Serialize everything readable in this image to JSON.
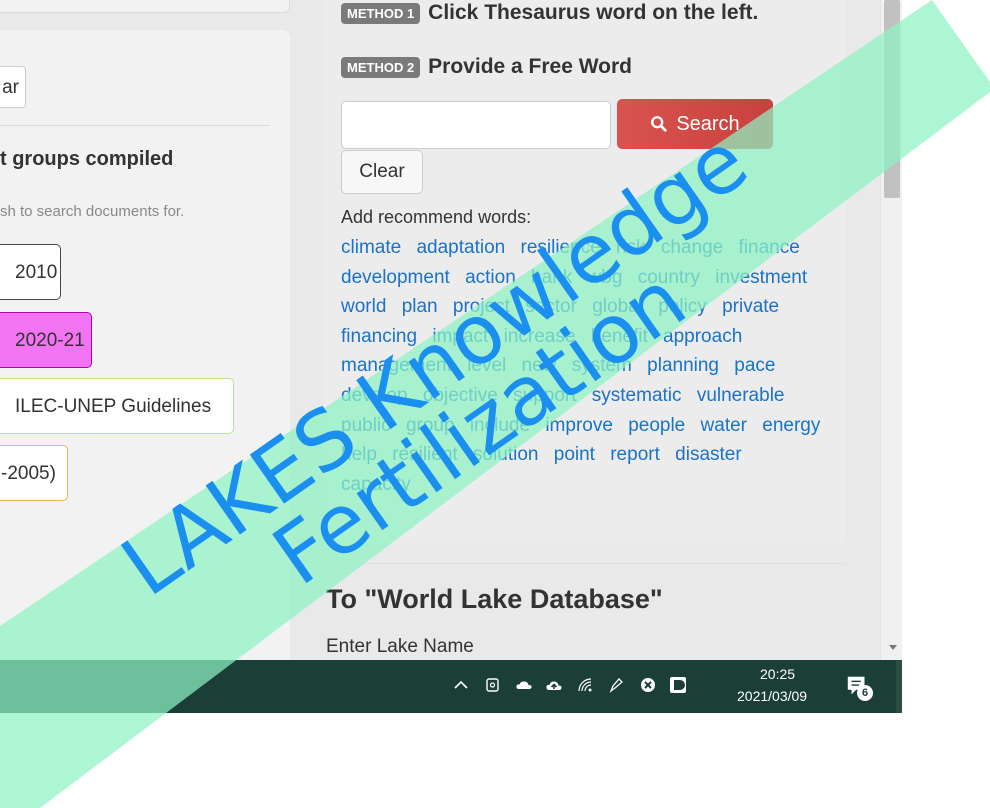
{
  "left_panel": {
    "clear_partial": "ar",
    "heading_partial": "t groups compiled",
    "hint_partial": "sh to search documents for.",
    "tags": [
      "2010",
      "2020-21",
      "ILEC-UNEP Guidelines",
      "-2005)"
    ]
  },
  "search_panel": {
    "method1_badge": "METHOD 1",
    "method1_text": "Click Thesaurus word on the left.",
    "method2_badge": "METHOD 2",
    "method2_text": "Provide a Free Word",
    "search_input_value": "",
    "search_button": "Search",
    "clear_button": "Clear",
    "recommend_label": "Add recommend words:",
    "words": [
      "climate",
      "adaptation",
      "resilience",
      "risk",
      "change",
      "finance",
      "development",
      "action",
      "bank",
      "wbg",
      "country",
      "investment",
      "world",
      "plan",
      "project",
      "sector",
      "global",
      "policy",
      "private",
      "financing",
      "impact",
      "increase",
      "benefit",
      "approach",
      "management",
      "level",
      "new",
      "system",
      "planning",
      "pace",
      "develop",
      "objective",
      "support",
      "systematic",
      "vulnerable",
      "public",
      "group",
      "include",
      "improve",
      "people",
      "water",
      "energy",
      "help",
      "resilient",
      "solution",
      "point",
      "report",
      "disaster",
      "capacity"
    ]
  },
  "lake_section": {
    "title": "To \"World Lake Database\"",
    "enter_label": "Enter Lake Name"
  },
  "taskbar": {
    "time": "20:25",
    "date": "2021/03/09",
    "notification_count": "6",
    "background_color": "#1b3f37"
  },
  "watermark": {
    "line1": "LAKES Knowledge",
    "line2": "Fertilization",
    "band_color": "#8ef2c4",
    "text_color": "#1a8ff0"
  }
}
